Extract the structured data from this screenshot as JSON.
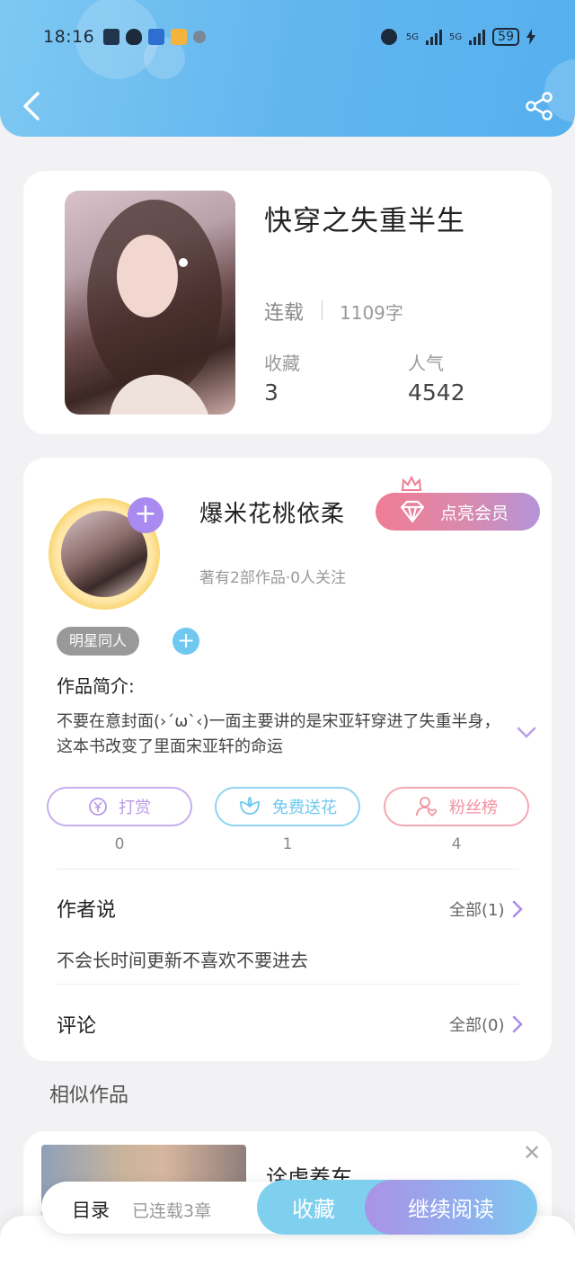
{
  "status_bar": {
    "time": "18:16",
    "network_1": "5G",
    "network_2": "5G",
    "battery": "59"
  },
  "book": {
    "title": "快穿之失重半生",
    "status": "连载",
    "word_count": "1109字",
    "favorites_label": "收藏",
    "favorites_value": "3",
    "popularity_label": "人气",
    "popularity_value": "4542"
  },
  "author": {
    "name": "爆米花桃依柔",
    "vip_button": "点亮会员",
    "meta": "著有2部作品·0人关注",
    "tag": "明星同人"
  },
  "intro": {
    "label": "作品简介:",
    "text": "不要在意封面(›´ω`‹)一面主要讲的是宋亚轩穿进了失重半身，这本书改变了里面宋亚轩的命运"
  },
  "actions": [
    {
      "label": "打赏",
      "count": "0",
      "icon": "yen-coin-icon",
      "color": "#b99be6"
    },
    {
      "label": "免费送花",
      "count": "1",
      "icon": "flower-icon",
      "color": "#6ec8ef"
    },
    {
      "label": "粉丝榜",
      "count": "4",
      "icon": "fan-user-icon",
      "color": "#f2919f"
    }
  ],
  "author_says": {
    "title": "作者说",
    "link": "全部(1)",
    "text": "不会长时间更新不喜欢不要进去"
  },
  "comments": {
    "title": "评论",
    "link": "全部(0)"
  },
  "similar": {
    "title": "相似作品",
    "item_name": "诠虎养车"
  },
  "bottom_bar": {
    "toc": "目录",
    "chapters": "已连载3章",
    "collect": "收藏",
    "read": "继续阅读"
  },
  "colors": {
    "header_blue": "#62b6ef",
    "accent_purple": "#a98af0",
    "accent_pink": "#f07c94"
  }
}
